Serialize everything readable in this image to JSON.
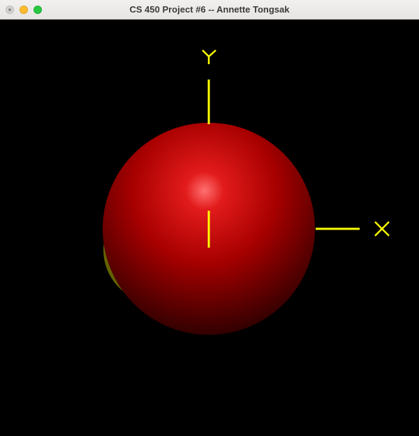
{
  "window": {
    "title": "CS 450 Project #6 -- Annette Tongsak",
    "controls": {
      "close": "close-button",
      "minimize": "minimize-button",
      "zoom": "zoom-button"
    }
  },
  "scene": {
    "background_color": "#000000",
    "axes_color": "#ffff00",
    "axis_labels": [
      "X",
      "Y"
    ],
    "objects": [
      {
        "name": "red-sphere",
        "color": "#cc0000",
        "highlight": "#ff6b6b"
      },
      {
        "name": "yellow-object",
        "color": "#c8c800"
      }
    ]
  }
}
